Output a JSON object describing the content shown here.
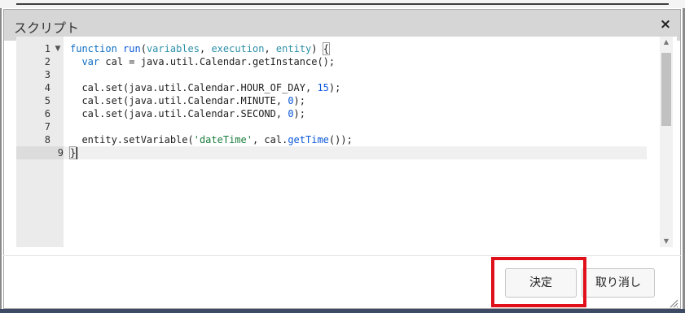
{
  "dialog": {
    "title": "スクリプト",
    "close_label": "×"
  },
  "editor": {
    "line_numbers": [
      "1",
      "2",
      "3",
      "4",
      "5",
      "6",
      "7",
      "8",
      "9"
    ],
    "active_line": "9",
    "lines": [
      "function run(variables, execution, entity) {",
      "  var cal = java.util.Calendar.getInstance();",
      "",
      "  cal.set(java.util.Calendar.HOUR_OF_DAY, 15);",
      "  cal.set(java.util.Calendar.MINUTE, 0);",
      "  cal.set(java.util.Calendar.SECOND, 0);",
      "",
      "  entity.setVariable('dateTime', cal.getTime());",
      "}"
    ]
  },
  "buttons": {
    "ok_label": "決定",
    "cancel_label": "取り消し"
  },
  "colors": {
    "titlebar": "#d6d6d6",
    "highlight": "#e0101a",
    "keyword": "#0e6ec4",
    "string": "#1a7d3c"
  },
  "icons": {
    "close": "close-icon",
    "fold": "fold-arrow-icon",
    "resize": "resize-grip-icon"
  }
}
